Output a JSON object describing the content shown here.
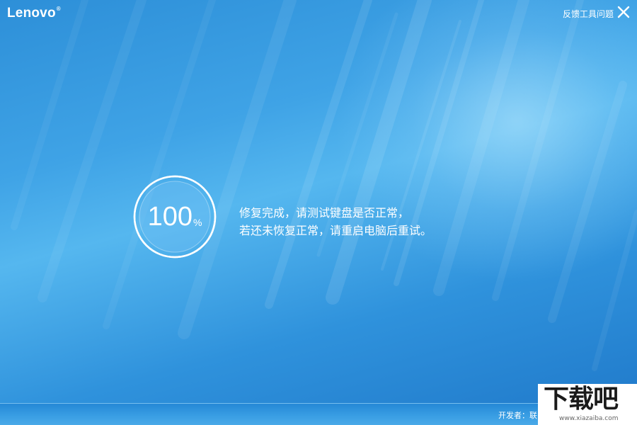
{
  "window": {
    "logo": "Lenovo",
    "logo_mark": "®",
    "feedback_label": "反馈工具问题",
    "close_icon": "close-icon"
  },
  "colors": {
    "background_start": "#2d8fd8",
    "background_end": "#1f78c9",
    "text": "#ffffff"
  },
  "progress": {
    "value": "100",
    "unit": "%",
    "fraction": 1.0
  },
  "message": {
    "line1": "修复完成，请测试键盘是否正常，",
    "line2": "若还未恢复正常，请重启电脑后重试。"
  },
  "footer": {
    "developer_label": "开发者：联"
  },
  "watermark": {
    "title": "下载吧",
    "url": "www.xiazaiba.com"
  }
}
